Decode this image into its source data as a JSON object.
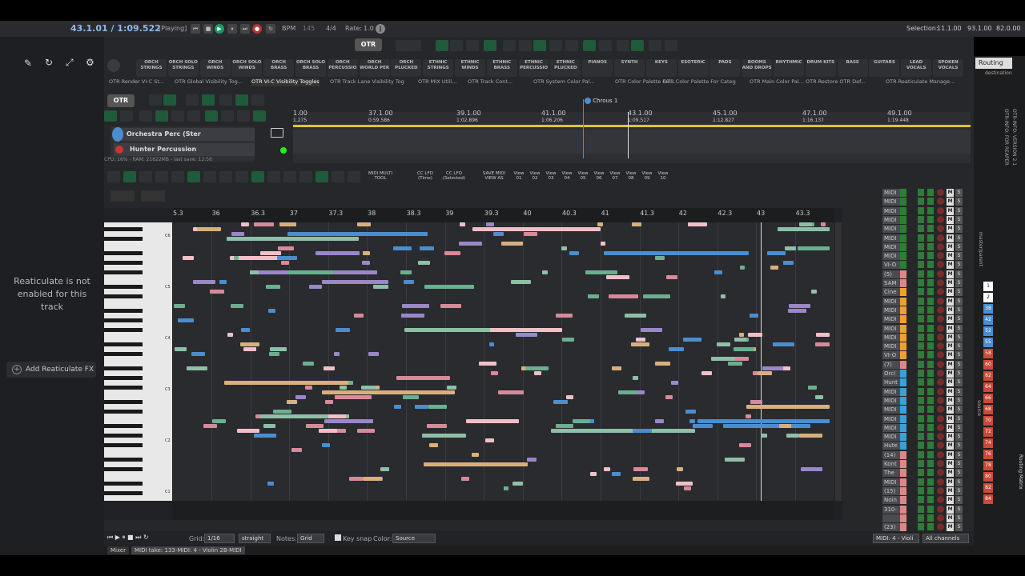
{
  "transport": {
    "position": "43.1.01 / 1:09.522",
    "state": "[Playing]",
    "bpm_label": "BPM",
    "bpm": "145",
    "timesig": "4/4",
    "rate_label": "Rate:",
    "rate": "1.0",
    "selection_label": "Selection:",
    "sel_start": "11.1.00",
    "sel_end": "93.1.00",
    "sel_len": "82.0.00"
  },
  "categories": [
    "ORCH STRINGS",
    "ORCH SOLO STRINGS",
    "ORCH WINDS",
    "ORCH SOLO WINDS",
    "ORCH BRASS",
    "ORCH SOLO BRASS",
    "ORCH PERCUSSIO",
    "ORCH WORLD PER",
    "ORCH PLUCKED",
    "ETHNIC STRINGS",
    "ETHNIC WINDS",
    "ETHNIC BRASS",
    "ETHNIC PERCUSSIO",
    "ETHNIC PLUCKED",
    "PIANOS",
    "SYNTH",
    "KEYS",
    "ESOTERIC",
    "PADS",
    "BOOMS AND DROPS",
    "RHYTHMIC",
    "DRUM KITS",
    "BASS",
    "GUITARS",
    "LEAD VOCALS",
    "SPOKEN VOCALS"
  ],
  "action_tabs": [
    "OTR Render VI-C St...",
    "OTR Global Visibility Tog...",
    "OTR VI-C Visibility Toggles",
    "OTR Track Lane Visibility Tog",
    "OTR MIX Utili...",
    "OTR Track Cont...",
    "OTR System Color Pal...",
    "OTR Color Palette For...",
    "OTR Color Palette For Categ",
    "OTR Main Color Pal...",
    "OTR Restore OTR Def...",
    "OTR Reaticulate Manage..."
  ],
  "routing": "Routing",
  "destination": "destination",
  "marker": "Chrous 1",
  "timeline": [
    {
      "bar": "1.00",
      "time": "1.275"
    },
    {
      "bar": "37.1.00",
      "time": "0:59.586"
    },
    {
      "bar": "39.1.00",
      "time": "1:02.896"
    },
    {
      "bar": "41.1.00",
      "time": "1:06.206"
    },
    {
      "bar": "43.1.00",
      "time": "1:09.517"
    },
    {
      "bar": "45.1.00",
      "time": "1:12.827"
    },
    {
      "bar": "47.1.00",
      "time": "1:16.137"
    },
    {
      "bar": "49.1.00",
      "time": "1:19.448"
    }
  ],
  "tracks": [
    {
      "name": "Orchestra Perc (Ster",
      "route": "Route"
    },
    {
      "name": "Hunter Percussion",
      "route": "Route"
    }
  ],
  "status": "CPU: 16% - RAM: 21622MB - last save: 12:56",
  "midi_buttons": [
    "MIDI MULTI TOOL",
    "CC LFO (Time)",
    "CC LFO (Selected)",
    "SAVE MIDI VIEW AS",
    "View 01",
    "View 02",
    "View 03",
    "View 04",
    "View 05",
    "View 06",
    "View 07",
    "View 08",
    "View 09",
    "View 10"
  ],
  "reaticulate": {
    "message": "Reaticulate is not enabled for this track",
    "add_button": "Add Reaticulate FX"
  },
  "midi_ruler": [
    "5.3",
    "36",
    "36.3",
    "37",
    "37.3",
    "38",
    "38.3",
    "39",
    "39.3",
    "40",
    "40.3",
    "41",
    "41.3",
    "42",
    "42.3",
    "43",
    "43.3"
  ],
  "key_labels": [
    "C6",
    "C5",
    "C4",
    "C3",
    "C2",
    "C1"
  ],
  "mixer_rows": [
    "MIDI",
    "MIDI",
    "MIDI",
    "MIDI",
    "MIDI",
    "MIDI",
    "MIDI",
    "MIDI",
    "VI-O",
    "(5)",
    "SAM",
    "Cine",
    "MIDI",
    "MIDI",
    "MIDI",
    "MIDI",
    "MIDI",
    "MIDI",
    "VI-O",
    "(7)",
    "Orcl",
    "Hunt",
    "MIDI",
    "MIDI",
    "MIDI",
    "MIDI",
    "MIDI",
    "MIDI",
    "Hute",
    "(14)",
    "Kont",
    "The",
    "MIDI",
    "(15)",
    "Noin",
    "310-",
    "",
    "(23)"
  ],
  "mixer_colors": [
    "#2e7d32",
    "#2e7d32",
    "#2e7d32",
    "#2e7d32",
    "#2e7d32",
    "#2e7d32",
    "#2e7d32",
    "#2e7d32",
    "#2e7d32",
    "#d88",
    "#d88",
    "#f0a030",
    "#f0a030",
    "#f0a030",
    "#f0a030",
    "#f0a030",
    "#f0a030",
    "#f0a030",
    "#f0a030",
    "#d88",
    "#3aa0d8",
    "#3aa0d8",
    "#3aa0d8",
    "#3aa0d8",
    "#3aa0d8",
    "#3aa0d8",
    "#3aa0d8",
    "#3aa0d8",
    "#3aa0d8",
    "#d88",
    "#d88",
    "#d88",
    "#d88",
    "#d88",
    "#d88",
    "#d88",
    "#d88",
    "#d88"
  ],
  "bottom": {
    "grid_label": "Grid:",
    "grid": "1/16",
    "swing": "straight",
    "notes_label": "Notes:",
    "notes": "Grid",
    "keysnap": "Key snap",
    "color_label": "Color:",
    "color": "Source",
    "midi_sel": "MIDI: 4 - Violi",
    "channels": "All channels"
  },
  "tabs": [
    "Mixer",
    "MIDI take: 133-MIDI: 4 - Violin 2B-MIDI"
  ],
  "right_panel": {
    "side_labels": [
      "OTR-INFO: VERSION 2.1",
      "OTR-INFO: FOR REAPER",
      "master/parent",
      "source",
      "Routing Matrix"
    ],
    "numbers": [
      "1",
      "2",
      "38",
      "42",
      "52",
      "55",
      "58",
      "60",
      "62",
      "64",
      "66",
      "68",
      "70",
      "72",
      "74",
      "76",
      "78",
      "80",
      "82",
      "84"
    ]
  }
}
